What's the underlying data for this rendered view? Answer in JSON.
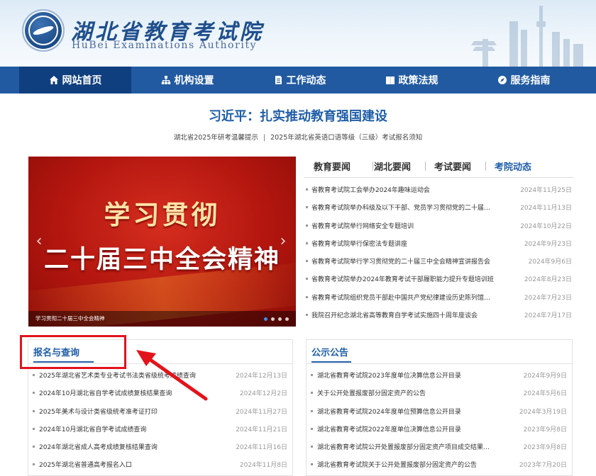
{
  "header": {
    "title": "湖北省教育考试院",
    "subtitle": "HuBei Examinations Authority"
  },
  "nav": {
    "items": [
      {
        "label": "网站首页",
        "icon": "home-icon"
      },
      {
        "label": "机构设置",
        "icon": "org-chart-icon"
      },
      {
        "label": "工作动态",
        "icon": "document-icon"
      },
      {
        "label": "政策法规",
        "icon": "book-icon"
      },
      {
        "label": "服务指南",
        "icon": "compass-icon"
      }
    ]
  },
  "headline": {
    "text": "习近平：扎实推动教育强国建设",
    "notice_1": "湖北省2025年研考温馨提示",
    "separator": "|",
    "notice_2": "2025年湖北省英语口语等级（三级）考试报名须知"
  },
  "carousel": {
    "line1": "学习贯彻",
    "line2": "二十届三中全会精神",
    "caption": "学习贯彻二十届三中全会精神",
    "prev_arrow": "‹",
    "next_arrow": "›",
    "slide_count": 4,
    "active_slide": 1
  },
  "news": {
    "tabs": [
      "教育要闻",
      "湖北要闻",
      "考试要闻",
      "考院动态"
    ],
    "active_tab": 3,
    "items": [
      {
        "title": "省教育考试院工会举办2024年趣味运动会",
        "date": "2024年11月25日"
      },
      {
        "title": "省教育考试院举办科级及以下干部、党员学习贯彻党的二十届…",
        "date": "2024年11月13日"
      },
      {
        "title": "省教育考试院举行网络安全专题培训",
        "date": "2024年10月22日"
      },
      {
        "title": "省教育考试院举行保密法专题讲座",
        "date": "2024年9月23日"
      },
      {
        "title": "省教育考试院举行学习贯彻党的二十届三中全会精神宣讲报告会",
        "date": "2024年9月6日"
      },
      {
        "title": "省教育考试院举办2024年教育考试干部履职能力提升专题培训班",
        "date": "2024年8月23日"
      },
      {
        "title": "省教育考试院组织党员干部赴中国共产党纪律建设历史陈列馆…",
        "date": "2024年7月23日"
      },
      {
        "title": "我院召开纪念湖北省高等教育自学考试实施四十周年座谈会",
        "date": "2024年7月17日"
      }
    ]
  },
  "registration": {
    "title": "报名与查询",
    "items": [
      {
        "title": "2025年湖北省艺术类专业考试书法类省级统考成绩查询",
        "date": "2024年12月13日"
      },
      {
        "title": "2024年10月湖北省自学考试成绩复核结果查询",
        "date": "2024年12月2日"
      },
      {
        "title": "2025年美术与设计类省级统考准考证打印",
        "date": "2024年11月27日"
      },
      {
        "title": "2024年10月湖北省自学考试成绩查询",
        "date": "2024年11月21日"
      },
      {
        "title": "2024年湖北省成人高考成绩复核结果查询",
        "date": "2024年11月16日"
      },
      {
        "title": "2025年湖北省普通高考报名入口",
        "date": "2024年11月8日"
      }
    ]
  },
  "announcements": {
    "title": "公示公告",
    "items": [
      {
        "title": "湖北省教育考试院2023年度单位决算信息公开目录",
        "date": "2024年9月9日"
      },
      {
        "title": "关于公开处置报废部分固定资产的公告",
        "date": "2024年5月6日"
      },
      {
        "title": "湖北省教育考试院2024年度单位预算信息公开目录",
        "date": "2024年3月19日"
      },
      {
        "title": "湖北省教育考试院2022年度单位决算信息公开目录",
        "date": "2023年9月8日"
      },
      {
        "title": "湖北省教育考试院公开处置报废部分固定资产项目成交结果…",
        "date": "2023年9月8日"
      },
      {
        "title": "湖北省教育考试院关于公开处置报废部分固定资产的公告",
        "date": "2023年7月20日"
      }
    ]
  },
  "colors": {
    "brand_blue": "#215aa1",
    "nav_active": "#0f3f7e",
    "link_blue": "#1f5ea8",
    "annotation_red": "#e3131b"
  }
}
